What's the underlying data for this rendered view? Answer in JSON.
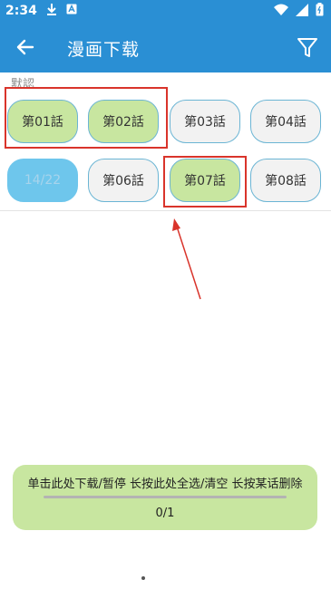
{
  "status_bar": {
    "time": "2:34"
  },
  "app_bar": {
    "title": "漫画下载"
  },
  "section": {
    "label": "默認"
  },
  "chapters": {
    "c01": {
      "label": "第01話",
      "state": "selected"
    },
    "c02": {
      "label": "第02話",
      "state": "selected"
    },
    "c03": {
      "label": "第03話",
      "state": "normal"
    },
    "c04": {
      "label": "第04話",
      "state": "normal"
    },
    "c05": {
      "label": "14/22",
      "state": "downloading"
    },
    "c06": {
      "label": "第06話",
      "state": "normal"
    },
    "c07": {
      "label": "第07話",
      "state": "selected"
    },
    "c08": {
      "label": "第08話",
      "state": "normal"
    }
  },
  "bottom_panel": {
    "instructions": "单击此处下载/暂停 长按此处全选/清空 长按某话删除",
    "progress_text": "0/1",
    "progress": 0
  },
  "colors": {
    "primary": "#2a8fd4",
    "selected_chip": "#c8e6a0",
    "downloading_chip": "#6ec6ec",
    "normal_chip": "#f2f2f2",
    "highlight": "#d9342b"
  }
}
